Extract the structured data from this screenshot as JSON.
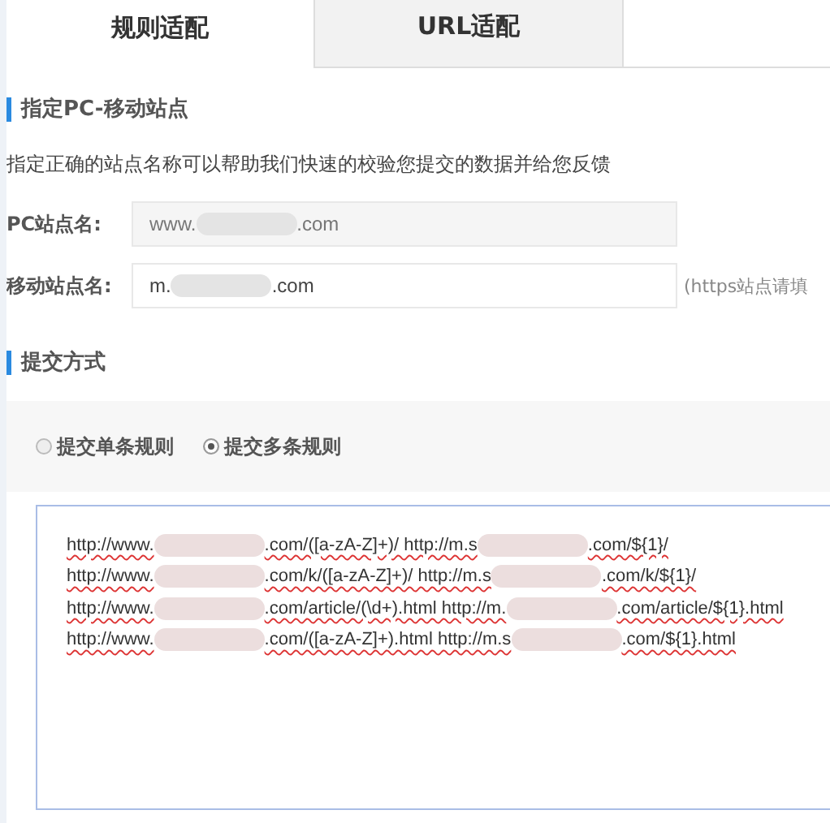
{
  "tabs": [
    {
      "label": "规则适配",
      "selected": true
    },
    {
      "label": "URL适配",
      "selected": false
    }
  ],
  "site_section": {
    "heading": "指定PC-移动站点",
    "description": "指定正确的站点名称可以帮助我们快速的校验您提交的数据并给您反馈",
    "fields": [
      {
        "label": "PC站点名:",
        "value_parts": [
          "www.",
          ".com"
        ],
        "disabled": true
      },
      {
        "label": "移动站点名:",
        "value_parts": [
          "m.",
          ".com"
        ],
        "disabled": false,
        "hint": "(https站点请填"
      }
    ]
  },
  "submit_section": {
    "heading": "提交方式",
    "options": [
      {
        "label": "提交单条规则",
        "selected": false
      },
      {
        "label": "提交多条规则",
        "selected": true
      }
    ],
    "rules": [
      {
        "parts": [
          "http://www.",
          ".com/([a-zA-Z]+)/ http://m.s",
          ".com/${1}/"
        ]
      },
      {
        "parts": [
          "http://www.",
          ".com/k/([a-zA-Z]+)/ http://m.s",
          ".com/k/${1}/"
        ]
      },
      {
        "parts": [
          "http://www.",
          ".com/article/(\\d+).html http://m.",
          ".com/article/${1}.html"
        ]
      },
      {
        "parts": [
          "http://www.",
          ".com/([a-zA-Z]+).html http://m.s",
          ".com/${1}.html"
        ]
      }
    ]
  }
}
